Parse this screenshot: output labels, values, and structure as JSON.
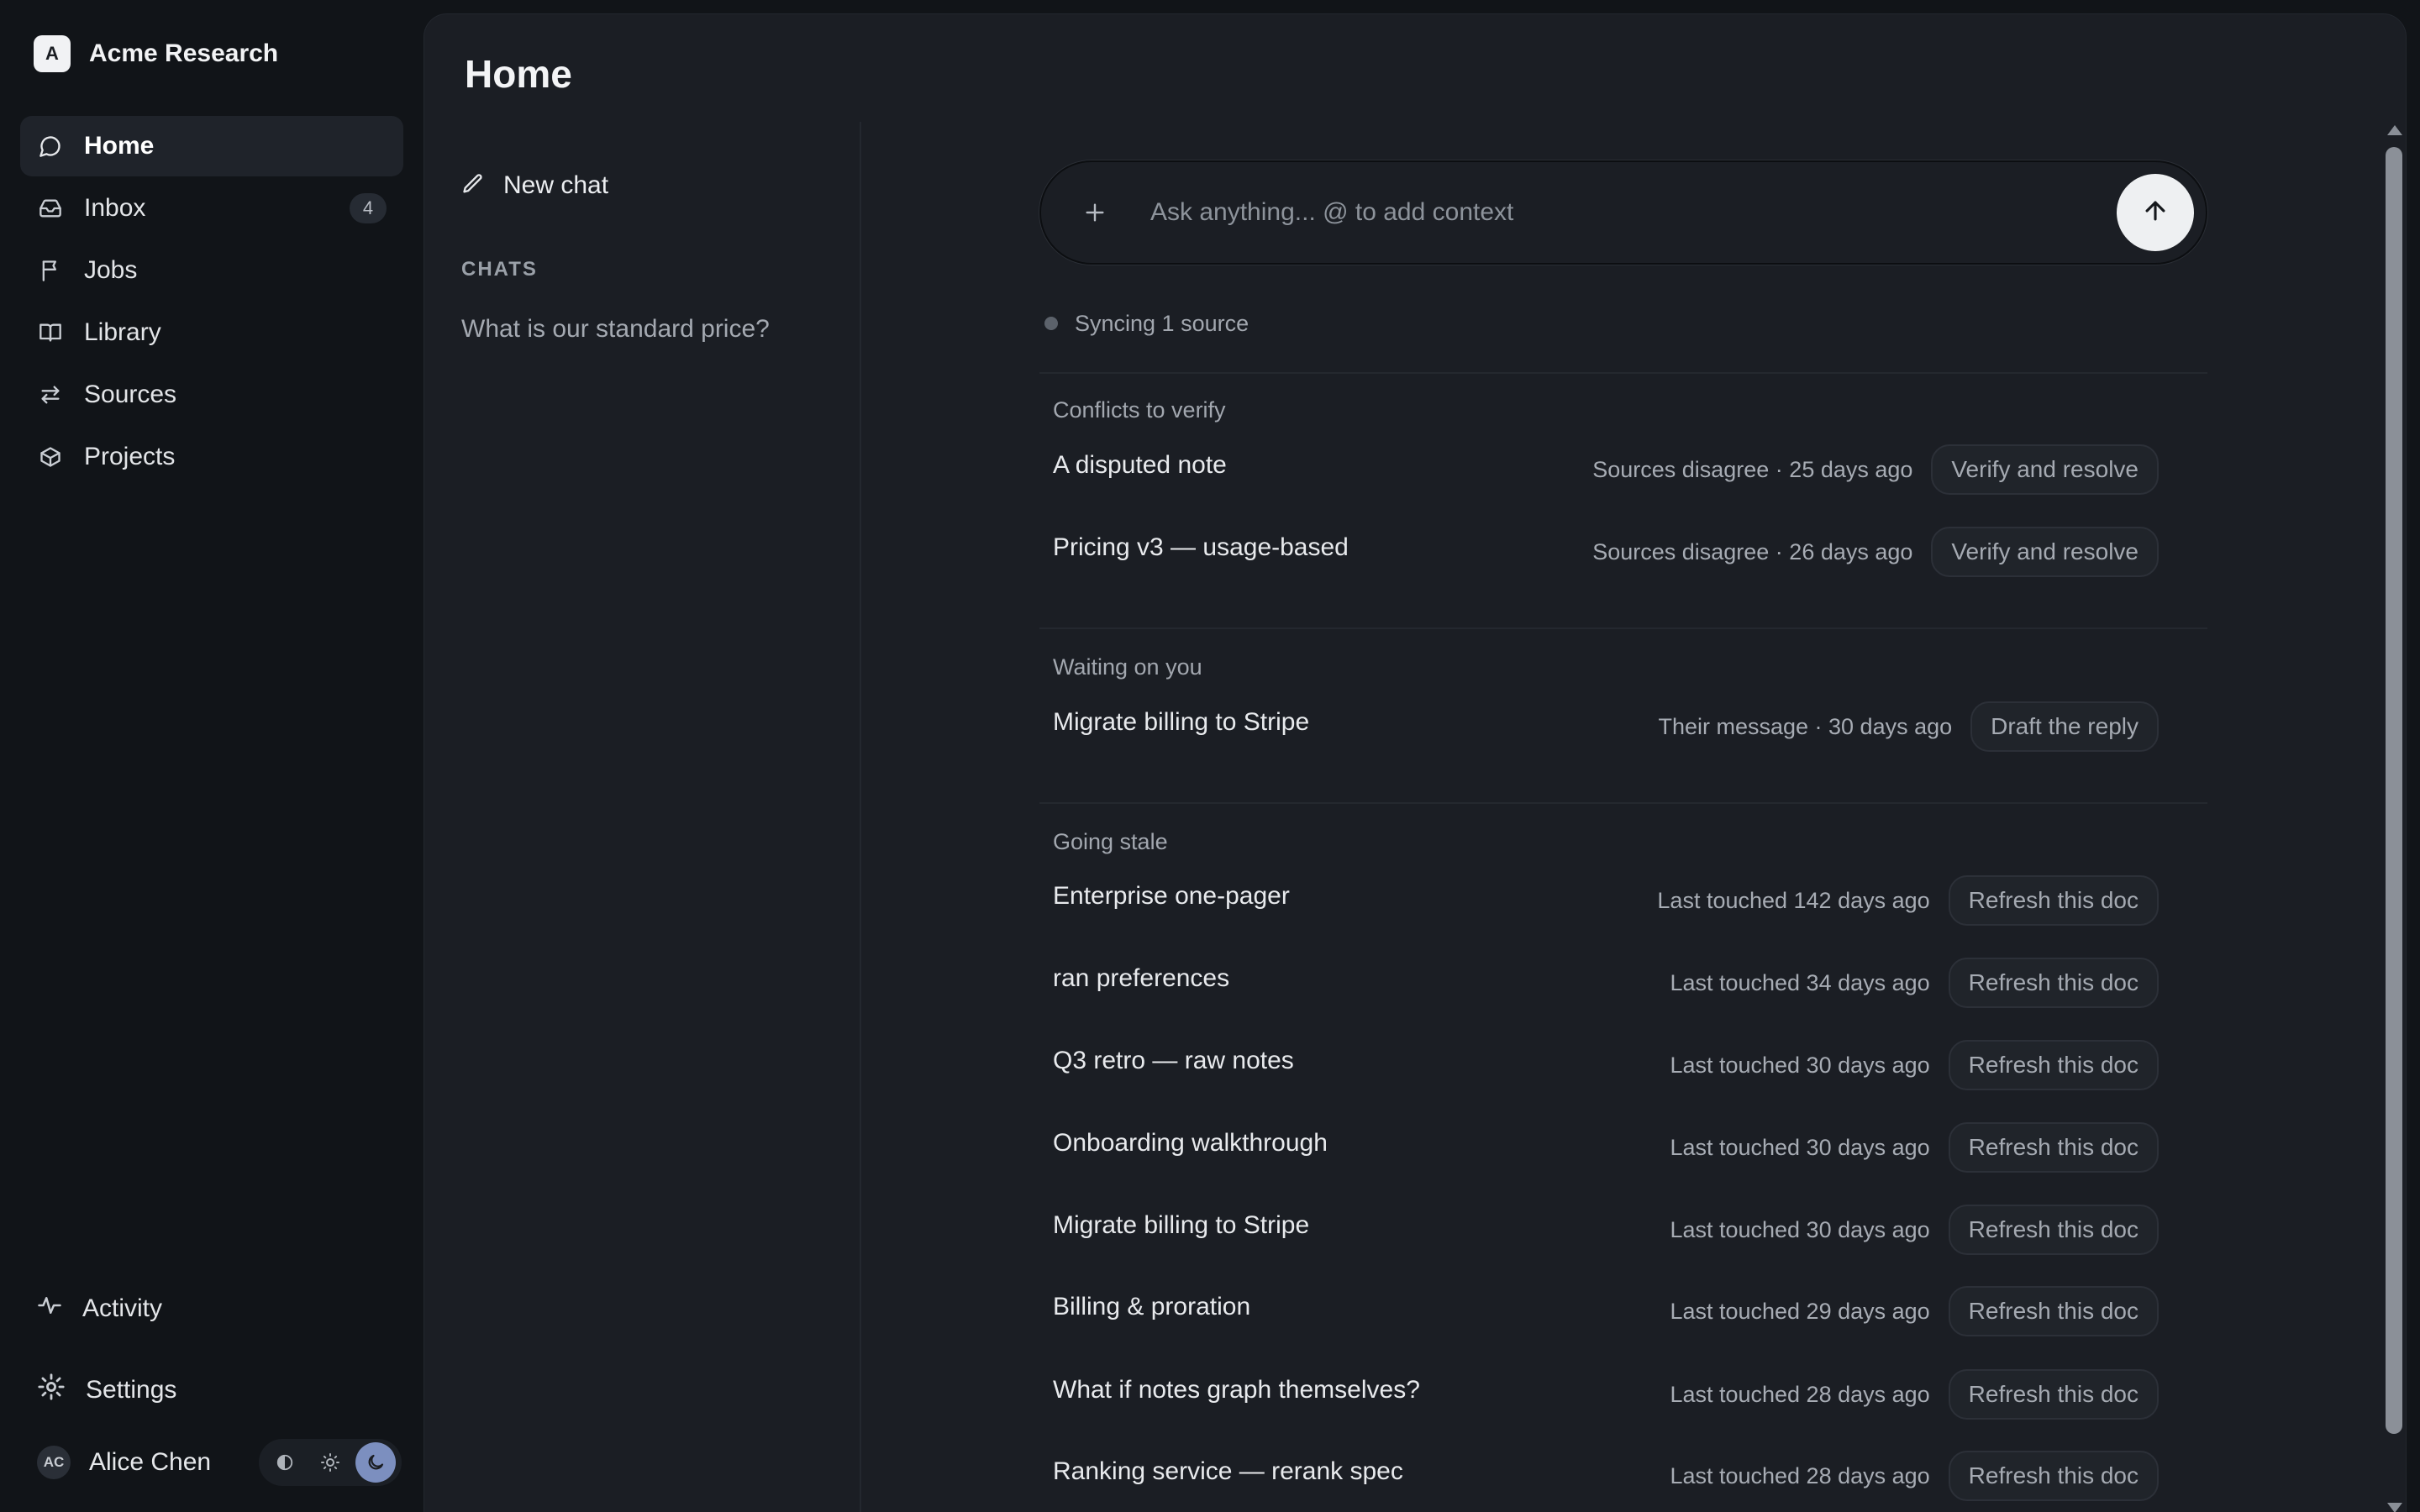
{
  "brand": {
    "logo_letter": "A",
    "name": "Acme Research"
  },
  "nav": [
    {
      "label": "Home",
      "icon": "chat-bubble-icon",
      "active": true
    },
    {
      "label": "Inbox",
      "icon": "inbox-icon",
      "badge": "4"
    },
    {
      "label": "Jobs",
      "icon": "flag-icon"
    },
    {
      "label": "Library",
      "icon": "book-icon"
    },
    {
      "label": "Sources",
      "icon": "arrows-swap-icon"
    },
    {
      "label": "Projects",
      "icon": "cube-icon"
    }
  ],
  "sidebar_bottom": {
    "activity": "Activity",
    "settings": "Settings",
    "user": {
      "initials": "AC",
      "name": "Alice Chen"
    },
    "theme_modes": [
      "system",
      "light",
      "dark"
    ],
    "theme_active": "dark"
  },
  "page": {
    "title": "Home"
  },
  "chats": {
    "new_chat": "New chat",
    "heading": "CHATS",
    "items": [
      "What is our standard price?"
    ]
  },
  "composer": {
    "placeholder": "Ask anything... @ to add context"
  },
  "sync_status": "Syncing 1 source",
  "sections": {
    "conflicts": {
      "title": "Conflicts to verify",
      "rows": [
        {
          "name": "A disputed note",
          "meta": "Sources disagree · 25 days ago",
          "action": "Verify and resolve"
        },
        {
          "name": "Pricing v3 — usage-based",
          "meta": "Sources disagree · 26 days ago",
          "action": "Verify and resolve"
        }
      ]
    },
    "waiting": {
      "title": "Waiting on you",
      "rows": [
        {
          "name": "Migrate billing to Stripe",
          "meta": "Their message · 30 days ago",
          "action": "Draft the reply"
        }
      ]
    },
    "stale": {
      "title": "Going stale",
      "rows": [
        {
          "name": "Enterprise one-pager",
          "meta": "Last touched 142 days ago",
          "action": "Refresh this doc"
        },
        {
          "name": "ran preferences",
          "meta": "Last touched 34 days ago",
          "action": "Refresh this doc"
        },
        {
          "name": "Q3 retro — raw notes",
          "meta": "Last touched 30 days ago",
          "action": "Refresh this doc"
        },
        {
          "name": "Onboarding walkthrough",
          "meta": "Last touched 30 days ago",
          "action": "Refresh this doc"
        },
        {
          "name": "Migrate billing to Stripe",
          "meta": "Last touched 30 days ago",
          "action": "Refresh this doc"
        },
        {
          "name": "Billing & proration",
          "meta": "Last touched 29 days ago",
          "action": "Refresh this doc"
        },
        {
          "name": "What if notes graph themselves?",
          "meta": "Last touched 28 days ago",
          "action": "Refresh this doc"
        },
        {
          "name": "Ranking service — rerank spec",
          "meta": "Last touched 28 days ago",
          "action": "Refresh this doc"
        }
      ]
    }
  },
  "colors": {
    "background": "#111418",
    "panel": "#1b1e24",
    "accent_theme": "#7c8fbf"
  }
}
